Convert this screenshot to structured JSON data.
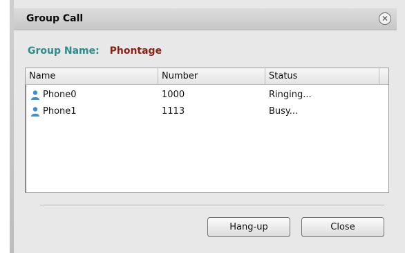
{
  "dialog": {
    "title": "Group Call",
    "close_icon": "close-icon"
  },
  "group": {
    "label": "Group Name:",
    "value": "Phontage"
  },
  "list": {
    "columns": [
      "Name",
      "Number",
      "Status"
    ],
    "rows": [
      {
        "name": "Phone0",
        "number": "1000",
        "status": "Ringing..."
      },
      {
        "name": "Phone1",
        "number": "1113",
        "status": "Busy..."
      }
    ]
  },
  "buttons": {
    "hangup": "Hang-up",
    "close": "Close"
  },
  "colors": {
    "group_label": "#2b8c8c",
    "group_value": "#8a1f12",
    "dialog_bg": "#e8e8e8"
  }
}
